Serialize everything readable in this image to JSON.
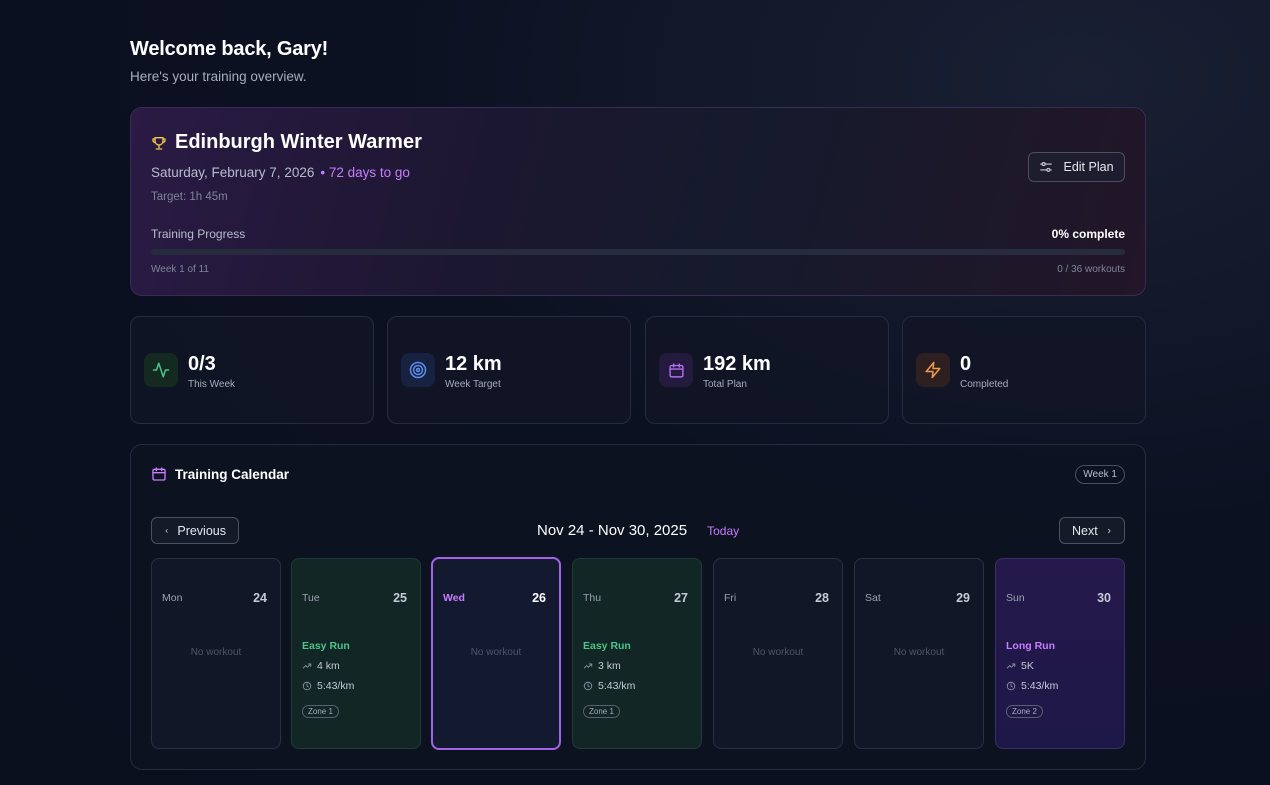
{
  "greeting": {
    "title": "Welcome back, Gary!",
    "subtitle": "Here's your training overview."
  },
  "race": {
    "icon": "trophy-icon",
    "name": "Edinburgh Winter Warmer",
    "date": "Saturday, February 7, 2026",
    "days_to_go": "• 72 days to go",
    "target": "Target: 1h 45m",
    "edit_label": "Edit Plan",
    "progress_label": "Training Progress",
    "progress_pct_text": "0% complete",
    "progress_fraction": 0,
    "week_text": "Week 1 of 11",
    "workouts_text": "0 / 36 workouts"
  },
  "stats": [
    {
      "value": "0/3",
      "label": "This Week",
      "icon": "activity-icon",
      "color": "#4cc38a"
    },
    {
      "value": "12 km",
      "label": "Week Target",
      "icon": "target-icon",
      "color": "#5b8def"
    },
    {
      "value": "192 km",
      "label": "Total Plan",
      "icon": "calendar-icon",
      "color": "#b06ef0"
    },
    {
      "value": "0",
      "label": "Completed",
      "icon": "zap-icon",
      "color": "#f2994a"
    }
  ],
  "calendar": {
    "title": "Training Calendar",
    "week_badge": "Week 1",
    "prev_label": "Previous",
    "next_label": "Next",
    "range": "Nov 24 - Nov 30, 2025",
    "today_label": "Today",
    "no_workout": "No workout",
    "days": [
      {
        "name": "Mon",
        "num": "24"
      },
      {
        "name": "Tue",
        "num": "25",
        "workout": "Easy Run",
        "distance": "4 km",
        "pace": "5:43/km",
        "zone": "Zone 1"
      },
      {
        "name": "Wed",
        "num": "26"
      },
      {
        "name": "Thu",
        "num": "27",
        "workout": "Easy Run",
        "distance": "3 km",
        "pace": "5:43/km",
        "zone": "Zone 1"
      },
      {
        "name": "Fri",
        "num": "28"
      },
      {
        "name": "Sat",
        "num": "29"
      },
      {
        "name": "Sun",
        "num": "30",
        "workout": "Long Run",
        "distance": "5K",
        "pace": "5:43/km",
        "zone": "Zone 2"
      }
    ]
  },
  "colors": {
    "accent": "#c77dff",
    "easy_run": "#4cc38a",
    "today_border": "#a363e8"
  }
}
